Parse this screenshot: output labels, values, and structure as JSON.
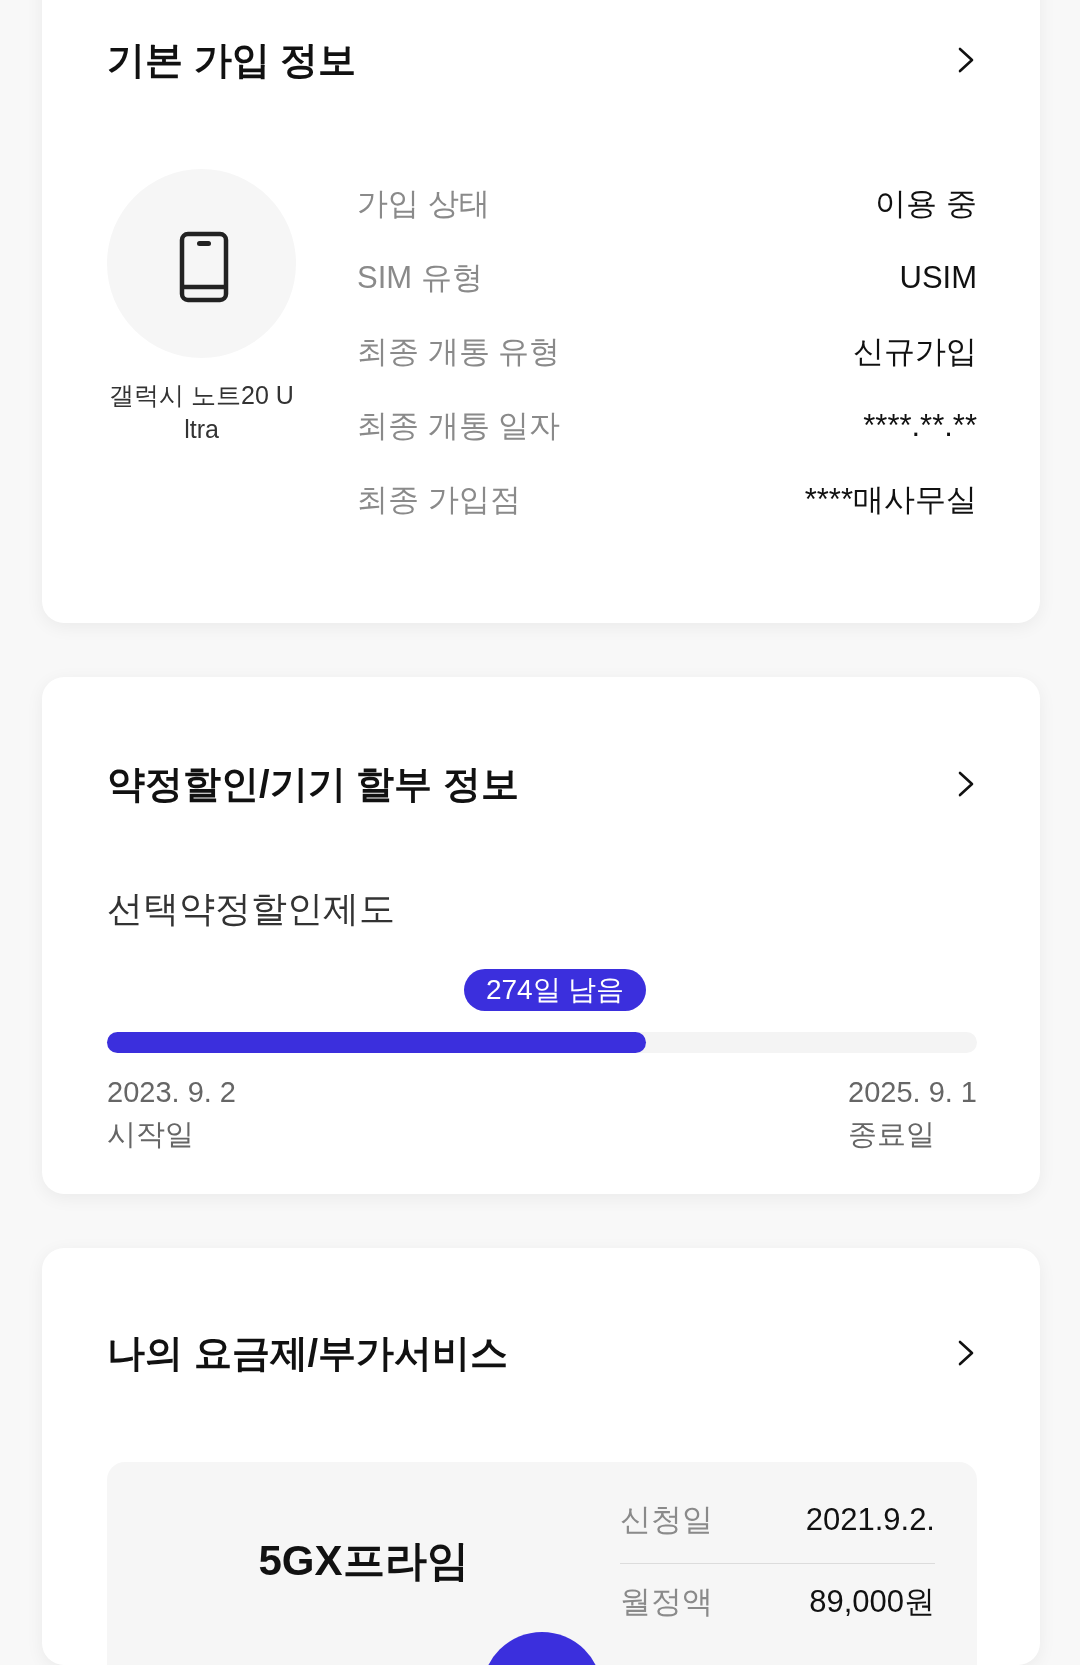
{
  "subscription_info": {
    "title": "기본 가입 정보",
    "device": {
      "name": "갤럭시 노트20 Ultra"
    },
    "rows": [
      {
        "label": "가입 상태",
        "value": "이용 중"
      },
      {
        "label": "SIM 유형",
        "value": "USIM"
      },
      {
        "label": "최종 개통 유형",
        "value": "신규가입"
      },
      {
        "label": "최종 개통 일자",
        "value": "****.**.**"
      },
      {
        "label": "최종 가입점",
        "value": "****매사무실"
      }
    ]
  },
  "contract_info": {
    "title": "약정할인/기기 할부 정보",
    "plan_type": "선택약정할인제도",
    "progress": {
      "badge": "274일 남음",
      "level": 0.62
    },
    "start": {
      "date": "2023. 9. 2",
      "label": "시작일"
    },
    "end": {
      "date": "2025. 9. 1",
      "label": "종료일"
    }
  },
  "plan_info": {
    "title": "나의 요금제/부가서비스",
    "plan": {
      "name": "5GX프라임",
      "rows": [
        {
          "label": "신청일",
          "value": "2021.9.2."
        },
        {
          "label": "월정액",
          "value": "89,000원"
        }
      ]
    }
  }
}
